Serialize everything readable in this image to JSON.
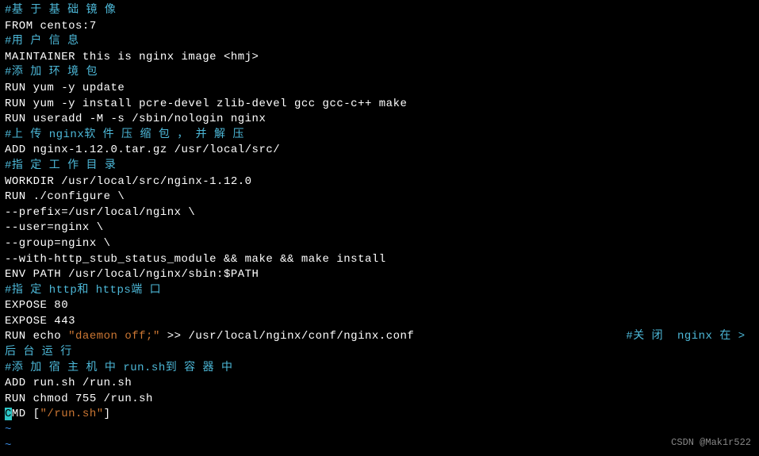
{
  "lines": {
    "l1": "#基 于 基 础 镜 像",
    "l2": "FROM centos:7",
    "l3": "#用 户 信 息",
    "l4": "MAINTAINER this is nginx image <hmj>",
    "l5": "#添 加 环 境 包",
    "l6": "RUN yum -y update",
    "l7": "RUN yum -y install pcre-devel zlib-devel gcc gcc-c++ make",
    "l8": "RUN useradd -M -s /sbin/nologin nginx",
    "l9a": "#上 传 ",
    "l9b": "nginx",
    "l9c": "软 件 压 缩 包 ， 并 解 压",
    "l10": "ADD nginx-1.12.0.tar.gz /usr/local/src/",
    "l11": "#指 定 工 作 目 录",
    "l12": "WORKDIR /usr/local/src/nginx-1.12.0",
    "l13": "RUN ./configure \\",
    "l14": "--prefix=/usr/local/nginx \\",
    "l15": "--user=nginx \\",
    "l16": "--group=nginx \\",
    "l17": "--with-http_stub_status_module && make && make install",
    "l18": "ENV PATH /usr/local/nginx/sbin:$PATH",
    "l19a": "#指 定 ",
    "l19b": "http",
    "l19c": "和 ",
    "l19d": "https",
    "l19e": "端 口",
    "l20": "EXPOSE 80",
    "l21": "EXPOSE 443",
    "l22a": "RUN echo ",
    "l22b": "\"daemon off;\"",
    "l22c": " >> /usr/local/nginx/conf/nginx.conf",
    "l22pad": "                              ",
    "l22d": "#关 闭  ",
    "l22e": "nginx ",
    "l22f": "在 >",
    "l23": "后 台 运 行",
    "l24a": "#添 加 宿 主 机 中 ",
    "l24b": "run.sh",
    "l24c": "到 容 器 中",
    "l25": "ADD run.sh /run.sh",
    "l26": "RUN chmod 755 /run.sh",
    "l27a": "C",
    "l27b": "MD [",
    "l27c": "\"/run.sh\"",
    "l27d": "]",
    "tilde": "~"
  },
  "watermark": "CSDN @Mak1r522"
}
